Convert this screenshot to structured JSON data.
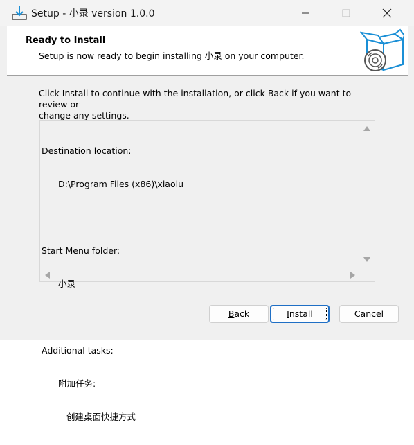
{
  "window": {
    "title": "Setup - 小录 version 1.0.0",
    "icon": "installer-download-icon",
    "controls": [
      "minimize-icon",
      "maximize-icon",
      "close-icon"
    ]
  },
  "header": {
    "title": "Ready to Install",
    "subtitle": "Setup is now ready to begin installing 小录 on your computer.",
    "image": "setup-box-disc-icon"
  },
  "main": {
    "instruction_line1": "Click Install to continue with the installation, or click Back if you want to review or",
    "instruction_line2": "change any settings.",
    "memo": {
      "dest_label": "Destination location:",
      "dest_value": "D:\\Program Files (x86)\\xiaolu",
      "menu_label": "Start Menu folder:",
      "menu_value": "小录",
      "tasks_label": "Additional tasks:",
      "tasks_group": "附加任务:",
      "tasks_item": "创建桌面快捷方式"
    }
  },
  "buttons": {
    "back_accel": "B",
    "back_rest": "ack",
    "install_accel": "I",
    "install_rest": "nstall",
    "cancel": "Cancel"
  },
  "colors": {
    "accent": "#1f6fc5",
    "icon_blue": "#1a8fd6"
  }
}
